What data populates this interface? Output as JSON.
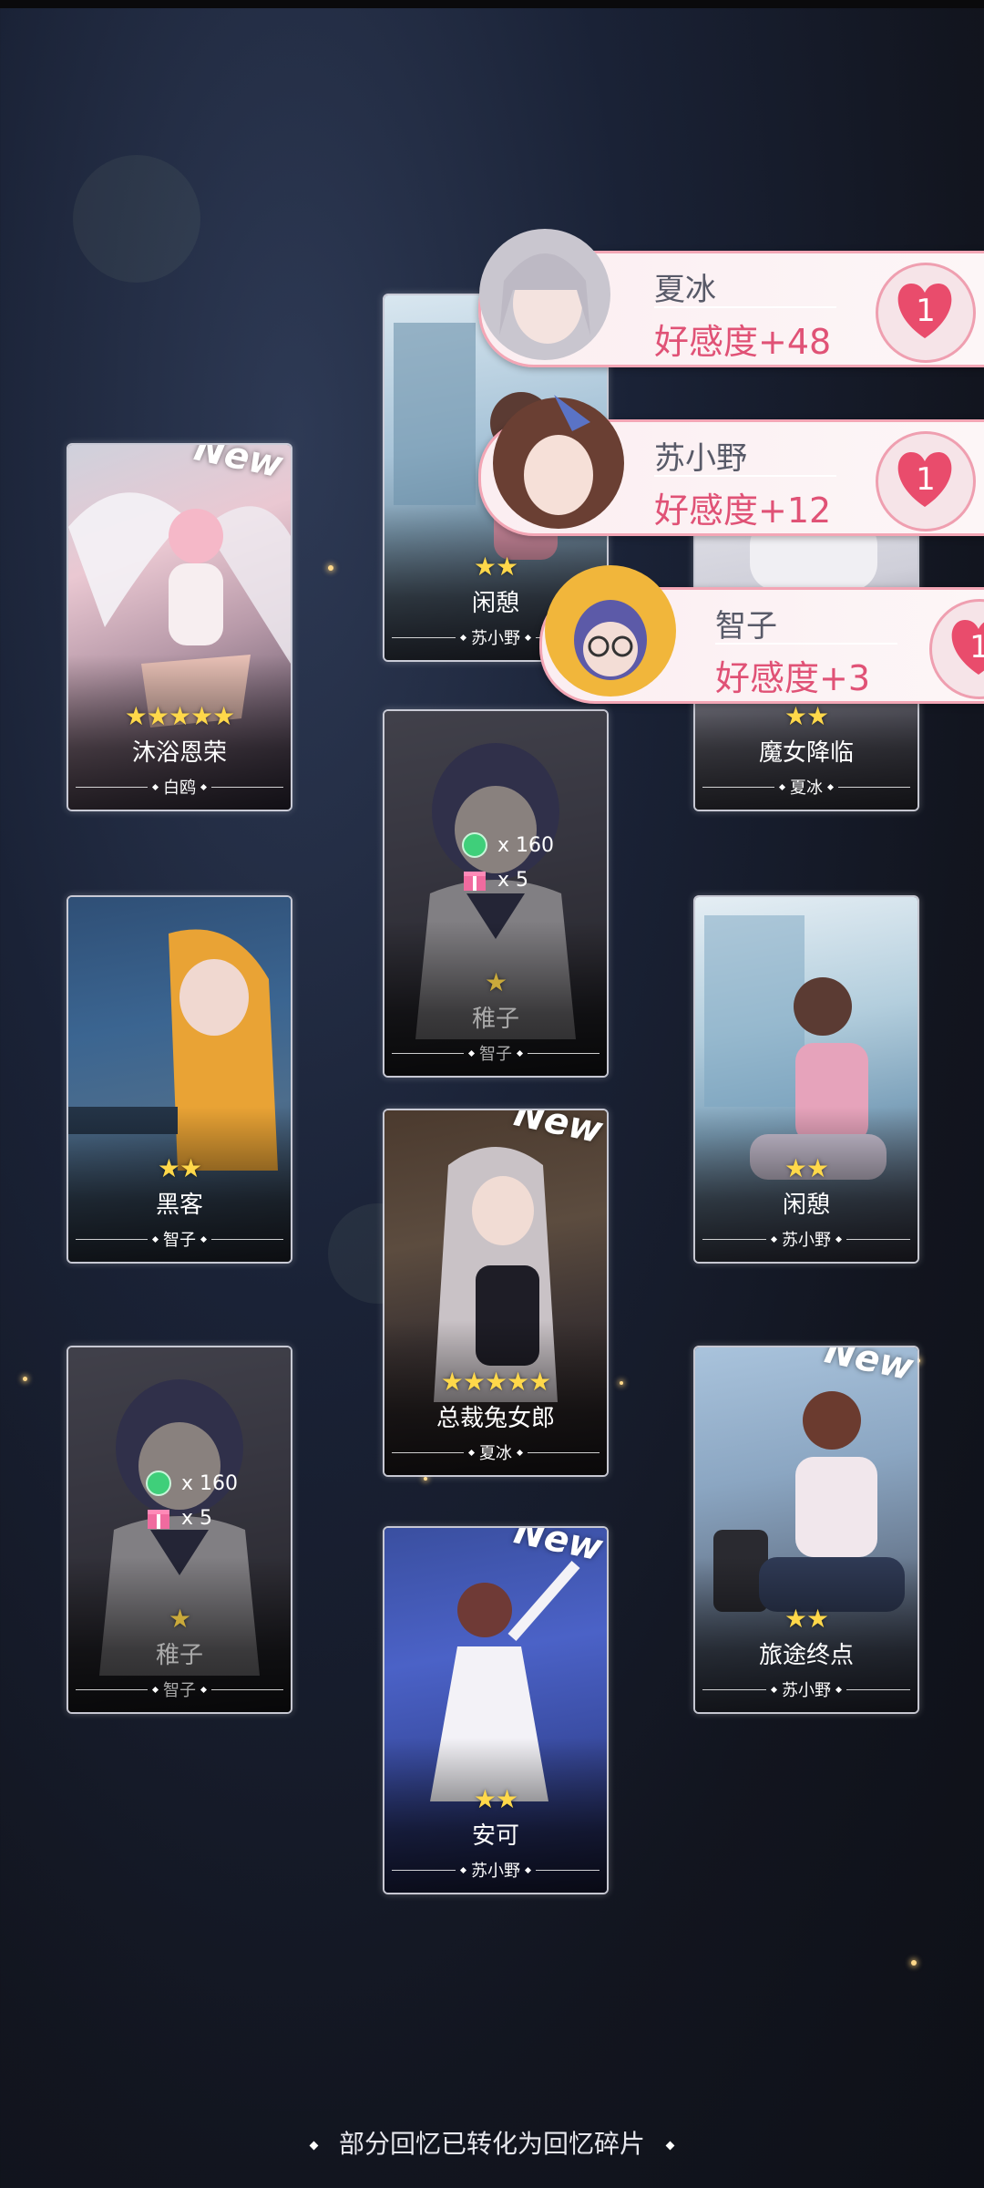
{
  "cards": [
    {
      "id": "c1",
      "stars": "★★★★★",
      "title": "沐浴恩荣",
      "owner": "白鸥",
      "new": "New"
    },
    {
      "id": "c2",
      "stars": "★★",
      "title": "闲憩",
      "owner": "苏小野",
      "new": ""
    },
    {
      "id": "c3",
      "stars": "★★",
      "title": "魔女降临",
      "owner": "夏冰",
      "new": ""
    },
    {
      "id": "c4",
      "stars": "★",
      "title": "稚子",
      "owner": "智子",
      "reward1": "x 160",
      "reward2": "x 5"
    },
    {
      "id": "c5",
      "stars": "★★",
      "title": "黑客",
      "owner": "智子",
      "new": ""
    },
    {
      "id": "c6",
      "stars": "★★",
      "title": "闲憩",
      "owner": "苏小野",
      "new": ""
    },
    {
      "id": "c7",
      "stars": "★★★★★",
      "title": "总裁兔女郎",
      "owner": "夏冰",
      "new": "New"
    },
    {
      "id": "c8",
      "stars": "★",
      "title": "稚子",
      "owner": "智子",
      "reward1": "x 160",
      "reward2": "x 5"
    },
    {
      "id": "c9",
      "stars": "★★",
      "title": "旅途终点",
      "owner": "苏小野",
      "new": "New"
    },
    {
      "id": "c10",
      "stars": "★★",
      "title": "安可",
      "owner": "苏小野",
      "new": "New"
    }
  ],
  "affinity": [
    {
      "name": "夏冰",
      "value": "好感度+48",
      "level": "1"
    },
    {
      "name": "苏小野",
      "value": "好感度+12",
      "level": "1"
    },
    {
      "name": "智子",
      "value": "好感度+3",
      "level": "1"
    }
  ],
  "footer": {
    "text": "部分回忆已转化为回忆碎片"
  },
  "colors": {
    "accent": "#e05276",
    "star": "#ffd84a",
    "panel_border": "#f3a6b5"
  },
  "icons": {
    "crystal": "green-gem-icon",
    "gift": "pink-gift-box-icon",
    "heart": "heart-icon"
  }
}
